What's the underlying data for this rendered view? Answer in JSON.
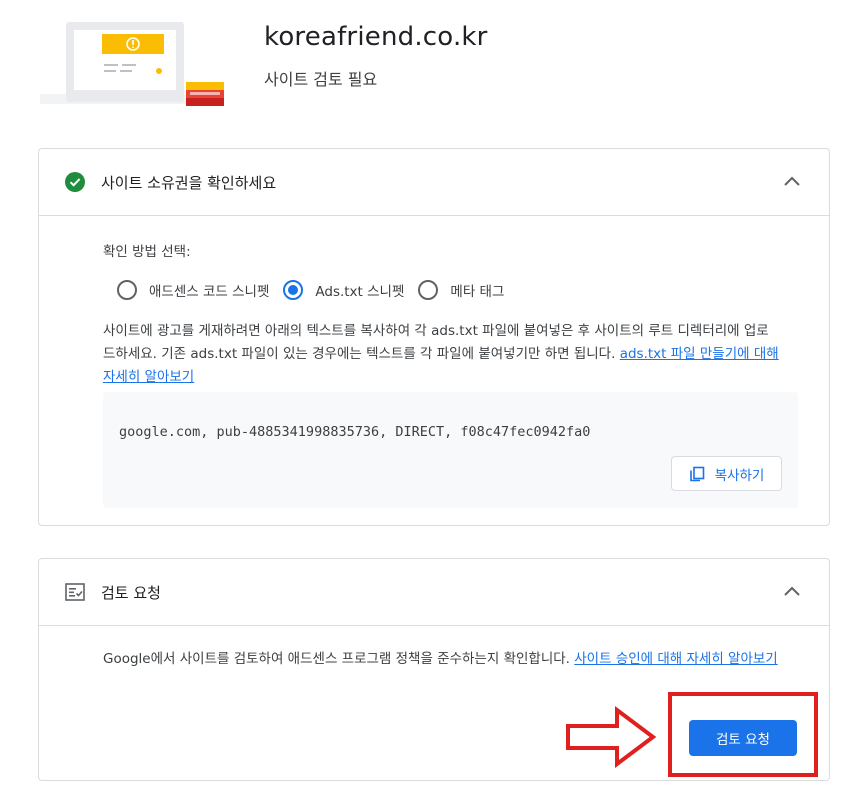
{
  "header": {
    "site": "koreafriend.co.kr",
    "status": "사이트 검토 필요"
  },
  "ownership": {
    "title": "사이트 소유권을 확인하세요",
    "method_label": "확인 방법 선택:",
    "options": [
      {
        "label": "애드센스 코드 스니펫",
        "checked": false
      },
      {
        "label": "Ads.txt 스니펫",
        "checked": true
      },
      {
        "label": "메타 태그",
        "checked": false
      }
    ],
    "description": "사이트에 광고를 게재하려면 아래의 텍스트를 복사하여 각 ads.txt 파일에 붙여넣은 후 사이트의 루트 디렉터리에 업로드하세요. 기존 ads.txt 파일이 있는 경우에는 텍스트를 각 파일에 붙여넣기만 하면 됩니다.",
    "link": "ads.txt 파일 만들기에 대해 자세히 알아보기",
    "code": "google.com, pub-4885341998835736, DIRECT, f08c47fec0942fa0",
    "copy_label": "복사하기"
  },
  "review": {
    "title": "검토 요청",
    "description": "Google에서 사이트를 검토하여 애드센스 프로그램 정책을 준수하는지 확인합니다.",
    "link": "사이트 승인에 대해 자세히 알아보기",
    "button": "검토 요청"
  },
  "colors": {
    "accent": "#1a73e8",
    "success": "#1e8e3e",
    "annotation": "#e0201e"
  }
}
